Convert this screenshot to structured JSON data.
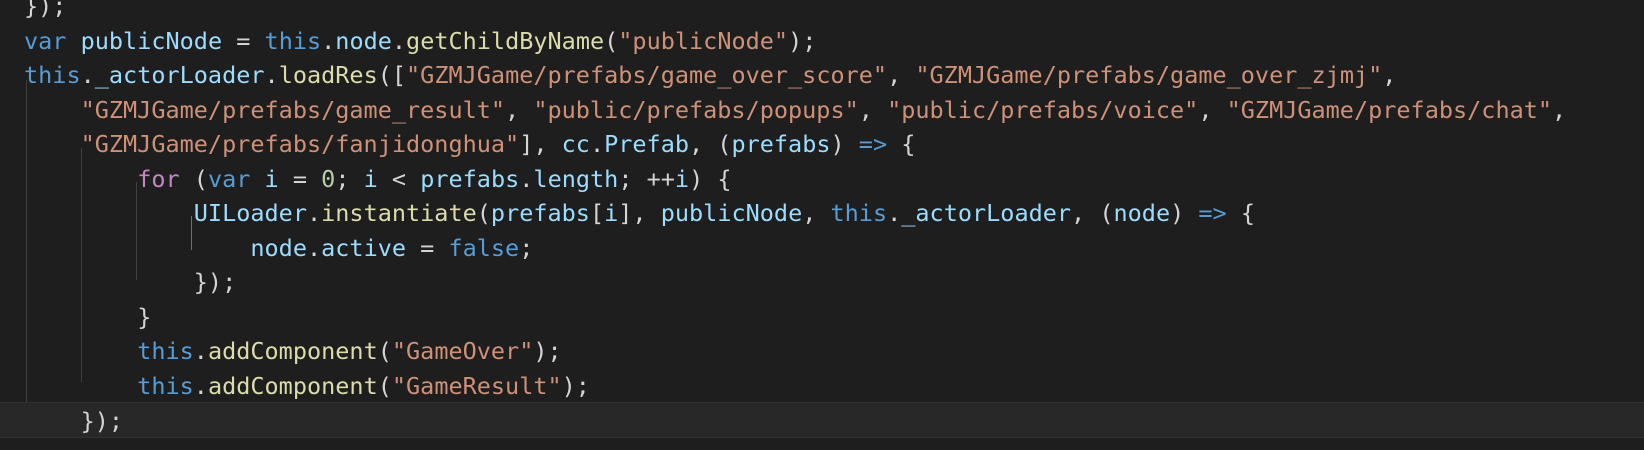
{
  "editor": {
    "colors": {
      "background": "#1e1e1e",
      "keyword": "#569cd6",
      "control": "#c586c0",
      "variable": "#9cdcfe",
      "function": "#dcdcaa",
      "string": "#ce9178",
      "number": "#b5cea8",
      "punctuation": "#d4d4d4"
    },
    "lines": [
      {
        "id": "line-0",
        "tokens": [
          {
            "t": "}",
            "c": "punc"
          },
          {
            "t": ");",
            "c": "punc"
          }
        ]
      },
      {
        "id": "line-1",
        "tokens": [
          {
            "t": "var",
            "c": "kw"
          },
          {
            "t": " ",
            "c": "punc"
          },
          {
            "t": "publicNode",
            "c": "var"
          },
          {
            "t": " = ",
            "c": "punc"
          },
          {
            "t": "this",
            "c": "kw"
          },
          {
            "t": ".",
            "c": "punc"
          },
          {
            "t": "node",
            "c": "var"
          },
          {
            "t": ".",
            "c": "punc"
          },
          {
            "t": "getChildByName",
            "c": "fn"
          },
          {
            "t": "(",
            "c": "punc"
          },
          {
            "t": "\"publicNode\"",
            "c": "str"
          },
          {
            "t": ");",
            "c": "punc"
          }
        ]
      },
      {
        "id": "line-2",
        "tokens": [
          {
            "t": "this",
            "c": "kw"
          },
          {
            "t": ".",
            "c": "punc"
          },
          {
            "t": "_actorLoader",
            "c": "var"
          },
          {
            "t": ".",
            "c": "punc"
          },
          {
            "t": "loadRes",
            "c": "fn"
          },
          {
            "t": "([",
            "c": "punc"
          },
          {
            "t": "\"GZMJGame/prefabs/game_over_score\"",
            "c": "str"
          },
          {
            "t": ", ",
            "c": "punc"
          },
          {
            "t": "\"GZMJGame/prefabs/game_over_zjmj\"",
            "c": "str"
          },
          {
            "t": ",",
            "c": "punc"
          }
        ]
      },
      {
        "id": "line-3",
        "tokens": [
          {
            "t": "    ",
            "c": "punc"
          },
          {
            "t": "\"GZMJGame/prefabs/game_result\"",
            "c": "str"
          },
          {
            "t": ", ",
            "c": "punc"
          },
          {
            "t": "\"public/prefabs/popups\"",
            "c": "str"
          },
          {
            "t": ", ",
            "c": "punc"
          },
          {
            "t": "\"public/prefabs/voice\"",
            "c": "str"
          },
          {
            "t": ", ",
            "c": "punc"
          },
          {
            "t": "\"GZMJGame/prefabs/chat\"",
            "c": "str"
          },
          {
            "t": ",",
            "c": "punc"
          }
        ]
      },
      {
        "id": "line-4",
        "tokens": [
          {
            "t": "    ",
            "c": "punc"
          },
          {
            "t": "\"GZMJGame/prefabs/fanjidonghua\"",
            "c": "str"
          },
          {
            "t": "], ",
            "c": "punc"
          },
          {
            "t": "cc",
            "c": "var"
          },
          {
            "t": ".",
            "c": "punc"
          },
          {
            "t": "Prefab",
            "c": "var"
          },
          {
            "t": ", (",
            "c": "punc"
          },
          {
            "t": "prefabs",
            "c": "var"
          },
          {
            "t": ") ",
            "c": "punc"
          },
          {
            "t": "=>",
            "c": "kw"
          },
          {
            "t": " {",
            "c": "punc"
          }
        ]
      },
      {
        "id": "line-5",
        "tokens": [
          {
            "t": "        ",
            "c": "punc"
          },
          {
            "t": "for",
            "c": "ctl"
          },
          {
            "t": " (",
            "c": "punc"
          },
          {
            "t": "var",
            "c": "kw"
          },
          {
            "t": " ",
            "c": "punc"
          },
          {
            "t": "i",
            "c": "var"
          },
          {
            "t": " = ",
            "c": "punc"
          },
          {
            "t": "0",
            "c": "num"
          },
          {
            "t": "; ",
            "c": "punc"
          },
          {
            "t": "i",
            "c": "var"
          },
          {
            "t": " < ",
            "c": "punc"
          },
          {
            "t": "prefabs",
            "c": "var"
          },
          {
            "t": ".",
            "c": "punc"
          },
          {
            "t": "length",
            "c": "var"
          },
          {
            "t": "; ++",
            "c": "punc"
          },
          {
            "t": "i",
            "c": "var"
          },
          {
            "t": ") {",
            "c": "punc"
          }
        ]
      },
      {
        "id": "line-6",
        "tokens": [
          {
            "t": "            ",
            "c": "punc"
          },
          {
            "t": "UILoader",
            "c": "var"
          },
          {
            "t": ".",
            "c": "punc"
          },
          {
            "t": "instantiate",
            "c": "fn"
          },
          {
            "t": "(",
            "c": "punc"
          },
          {
            "t": "prefabs",
            "c": "var"
          },
          {
            "t": "[",
            "c": "punc"
          },
          {
            "t": "i",
            "c": "var"
          },
          {
            "t": "], ",
            "c": "punc"
          },
          {
            "t": "publicNode",
            "c": "var"
          },
          {
            "t": ", ",
            "c": "punc"
          },
          {
            "t": "this",
            "c": "kw"
          },
          {
            "t": ".",
            "c": "punc"
          },
          {
            "t": "_actorLoader",
            "c": "var"
          },
          {
            "t": ", (",
            "c": "punc"
          },
          {
            "t": "node",
            "c": "var"
          },
          {
            "t": ") ",
            "c": "punc"
          },
          {
            "t": "=>",
            "c": "kw"
          },
          {
            "t": " {",
            "c": "punc"
          }
        ]
      },
      {
        "id": "line-7",
        "tokens": [
          {
            "t": "                ",
            "c": "punc"
          },
          {
            "t": "node",
            "c": "var"
          },
          {
            "t": ".",
            "c": "punc"
          },
          {
            "t": "active",
            "c": "var"
          },
          {
            "t": " = ",
            "c": "punc"
          },
          {
            "t": "false",
            "c": "kw"
          },
          {
            "t": ";",
            "c": "punc"
          }
        ]
      },
      {
        "id": "line-8",
        "tokens": [
          {
            "t": "            ",
            "c": "punc"
          },
          {
            "t": "});",
            "c": "punc"
          }
        ]
      },
      {
        "id": "line-9",
        "tokens": [
          {
            "t": "        ",
            "c": "punc"
          },
          {
            "t": "}",
            "c": "punc"
          }
        ]
      },
      {
        "id": "line-10",
        "tokens": [
          {
            "t": "        ",
            "c": "punc"
          },
          {
            "t": "this",
            "c": "kw"
          },
          {
            "t": ".",
            "c": "punc"
          },
          {
            "t": "addComponent",
            "c": "fn"
          },
          {
            "t": "(",
            "c": "punc"
          },
          {
            "t": "\"GameOver\"",
            "c": "str"
          },
          {
            "t": ");",
            "c": "punc"
          }
        ]
      },
      {
        "id": "line-11",
        "tokens": [
          {
            "t": "        ",
            "c": "punc"
          },
          {
            "t": "this",
            "c": "kw"
          },
          {
            "t": ".",
            "c": "punc"
          },
          {
            "t": "addComponent",
            "c": "fn"
          },
          {
            "t": "(",
            "c": "punc"
          },
          {
            "t": "\"GameResult\"",
            "c": "str"
          },
          {
            "t": ");",
            "c": "punc"
          }
        ]
      },
      {
        "id": "line-12",
        "current": true,
        "tokens": [
          {
            "t": "    ",
            "c": "punc"
          },
          {
            "t": "});",
            "c": "punc"
          }
        ]
      }
    ]
  }
}
